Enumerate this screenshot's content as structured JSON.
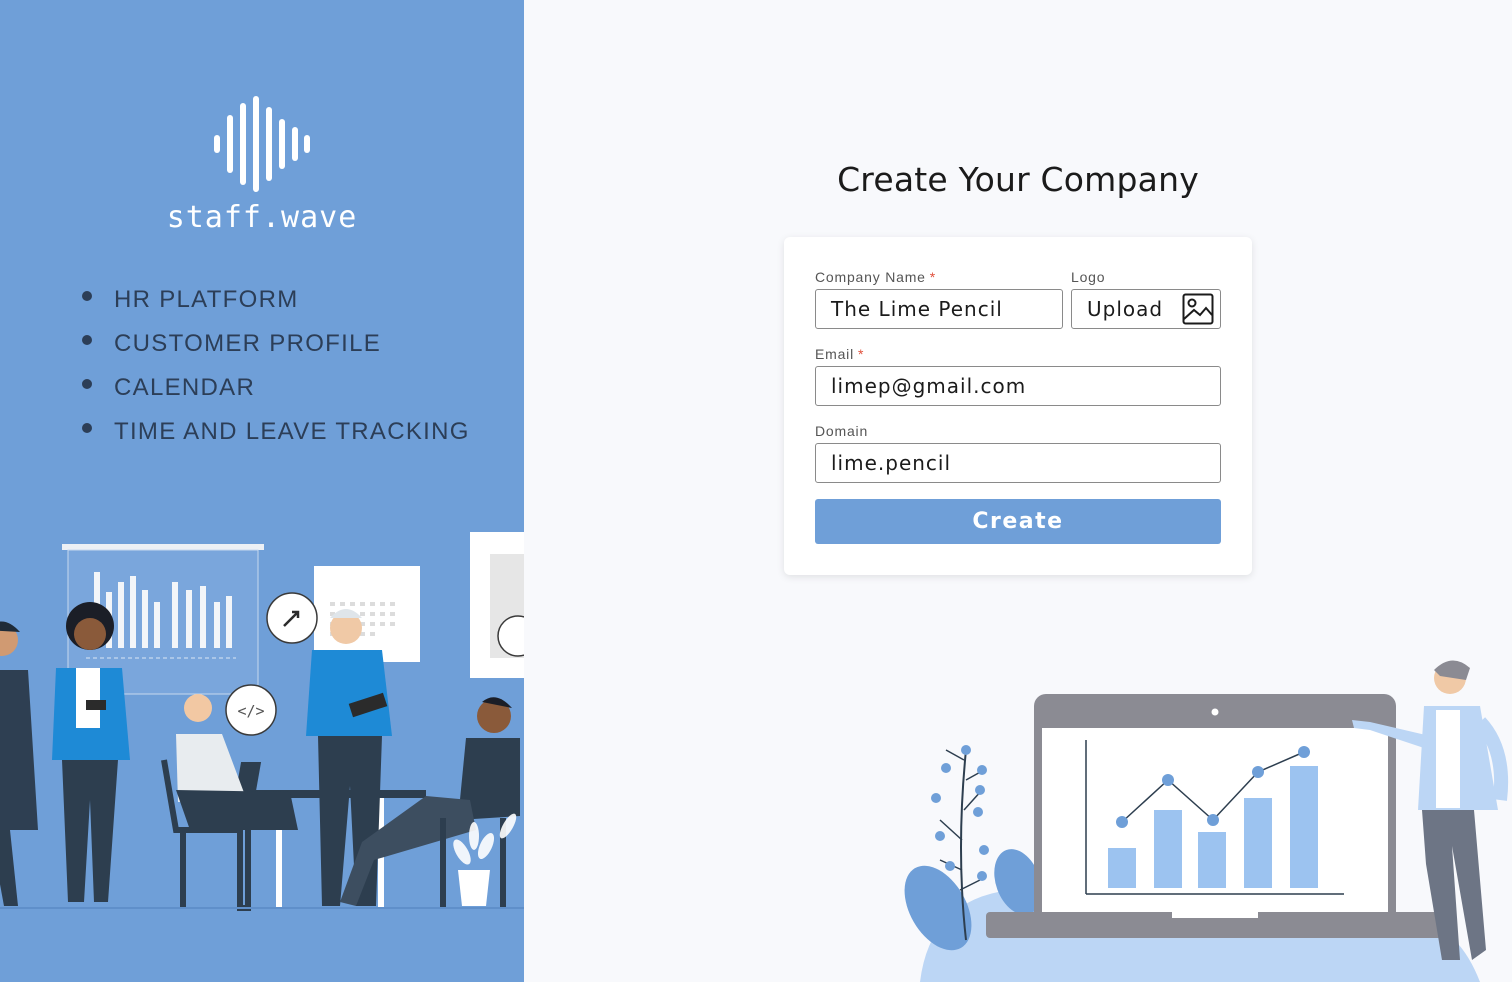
{
  "brand": {
    "name": "staff.wave",
    "logo_icon": "sound-wave-icon",
    "panel_color": "#6f9fd8"
  },
  "features": [
    {
      "label": "HR PLATFORM"
    },
    {
      "label": "CUSTOMER PROFILE"
    },
    {
      "label": "CALENDAR"
    },
    {
      "label": "TIME AND LEAVE TRACKING"
    }
  ],
  "page": {
    "title": "Create Your Company"
  },
  "form": {
    "company_name": {
      "label": "Company Name",
      "required_mark": "*",
      "value": "The Lime Pencil"
    },
    "logo": {
      "label": "Logo",
      "button_label": "Upload",
      "icon": "image-icon"
    },
    "email": {
      "label": "Email",
      "required_mark": "*",
      "value": "limep@gmail.com"
    },
    "domain": {
      "label": "Domain",
      "value": "lime.pencil"
    },
    "submit_label": "Create"
  },
  "colors": {
    "accent": "#6f9fd8",
    "required": "#e0503c",
    "background": "#f8f9fc"
  }
}
